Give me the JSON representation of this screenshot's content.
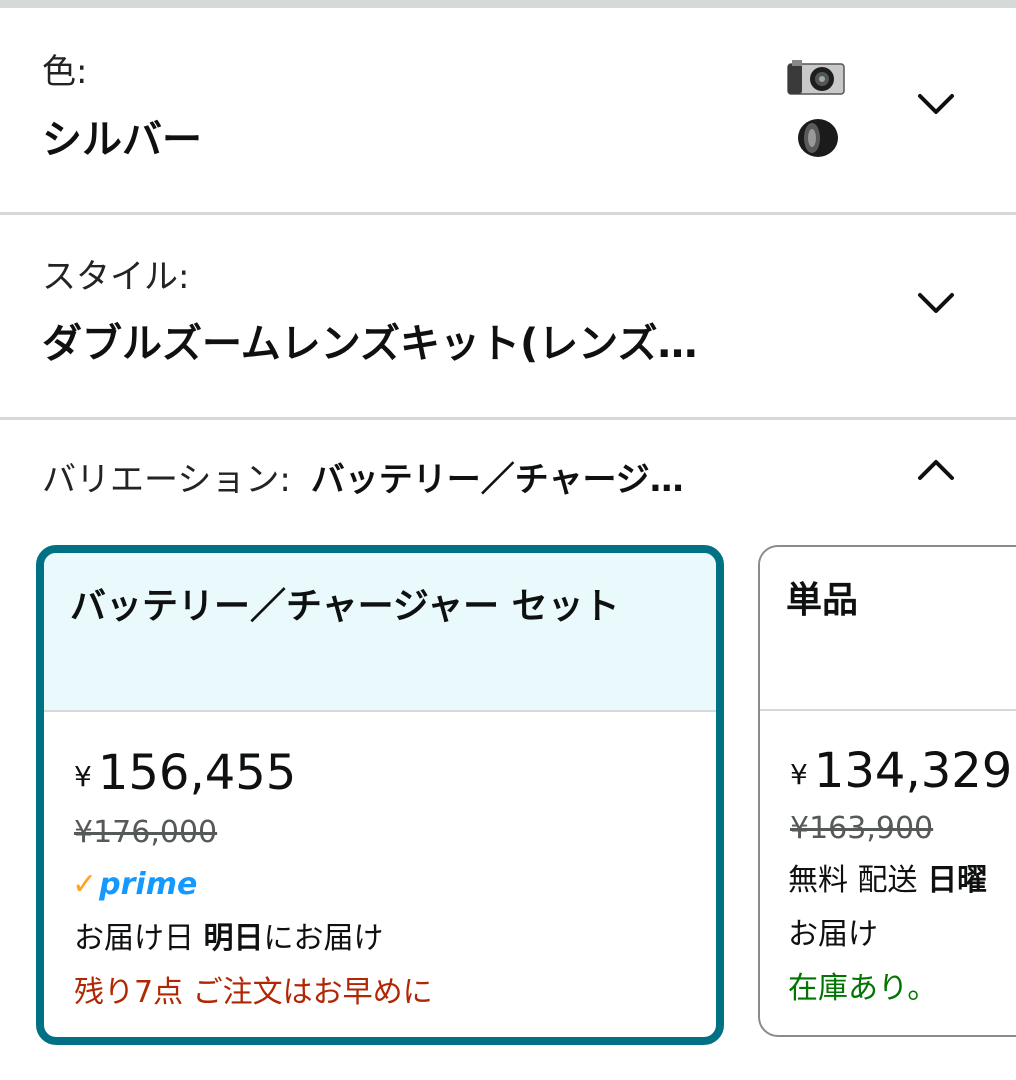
{
  "color": {
    "label": "色:",
    "value": "シルバー"
  },
  "style": {
    "label": "スタイル:",
    "value": "ダブルズームレンズキット(レンズ…"
  },
  "variation": {
    "label": "バリエーション:",
    "value": "バッテリー／チャージ…"
  },
  "icons": {
    "color_chevron": "chevron-down-icon",
    "style_chevron": "chevron-down-icon",
    "variation_chevron": "chevron-up-icon"
  },
  "options": [
    {
      "title": "バッテリー／チャージャー セット",
      "yen": "¥",
      "price": "156,455",
      "list_price": "¥176,000",
      "prime": "prime",
      "delivery_prefix": "お届け日",
      "delivery_bold": "明日",
      "delivery_suffix": "にお届け",
      "stock": "残り7点 ご注文はお早めに",
      "selected": true
    },
    {
      "title": "単品",
      "yen": "¥",
      "price": "134,329",
      "list_price": "¥163,900",
      "shipping_prefix": "無料 配送",
      "shipping_bold": "日曜",
      "shipping_line2": "お届け",
      "stock": "在庫あり。",
      "selected": false
    }
  ],
  "colors": {
    "selected_border": "#007185",
    "selected_bg": "#e9f9fc",
    "stock_low": "#b12704",
    "in_stock": "#007600",
    "prime": "#1399ff"
  }
}
